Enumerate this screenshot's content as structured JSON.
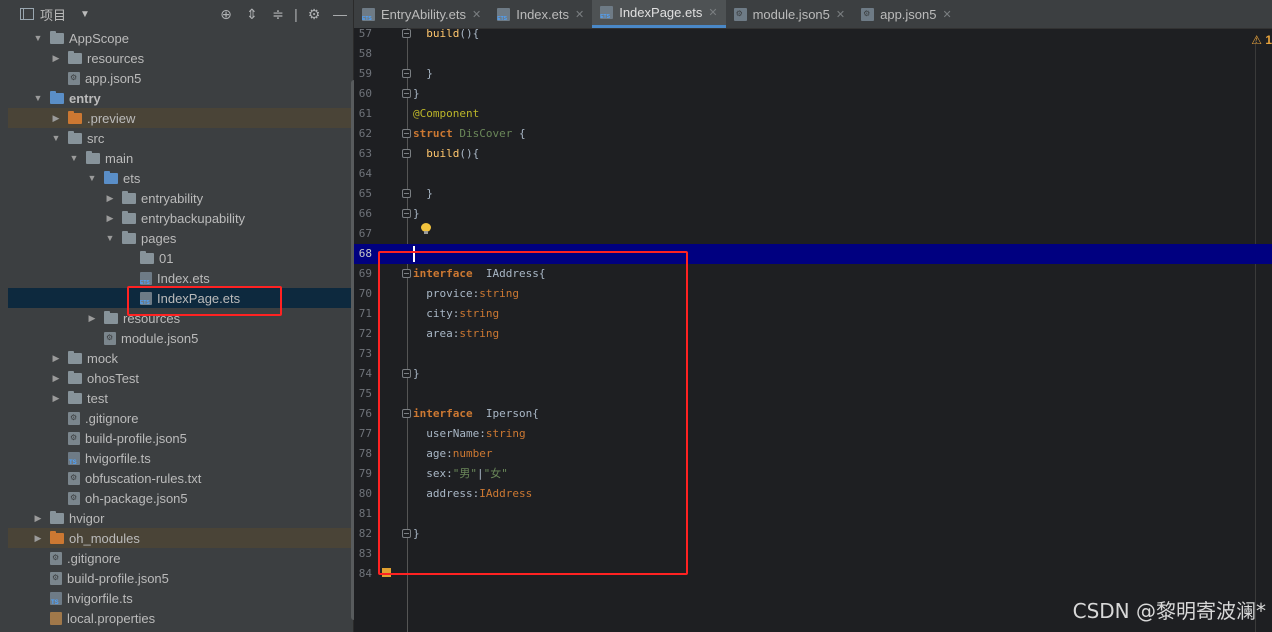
{
  "project_panel": {
    "title": "项目",
    "header_icons": [
      "crosshair-icon",
      "expand-all-icon",
      "collapse-all-icon",
      "gear-icon",
      "minimize-icon"
    ]
  },
  "tree": [
    {
      "label": "AppScope",
      "type": "folder",
      "expanded": true
    },
    {
      "label": "resources",
      "type": "folder",
      "expanded": false
    },
    {
      "label": "app.json5",
      "type": "config"
    },
    {
      "label": "entry",
      "type": "folder-blue",
      "expanded": true,
      "bold": true
    },
    {
      "label": ".preview",
      "type": "folder-orange",
      "expanded": false
    },
    {
      "label": "src",
      "type": "folder",
      "expanded": true
    },
    {
      "label": "main",
      "type": "folder",
      "expanded": true
    },
    {
      "label": "ets",
      "type": "folder-blue",
      "expanded": true
    },
    {
      "label": "entryability",
      "type": "folder",
      "expanded": false
    },
    {
      "label": "entrybackupability",
      "type": "folder",
      "expanded": false
    },
    {
      "label": "pages",
      "type": "folder",
      "expanded": true
    },
    {
      "label": "01",
      "type": "folder"
    },
    {
      "label": "Index.ets",
      "type": "ets"
    },
    {
      "label": "IndexPage.ets",
      "type": "ets",
      "selected": true
    },
    {
      "label": "resources",
      "type": "folder",
      "expanded": false
    },
    {
      "label": "module.json5",
      "type": "config"
    },
    {
      "label": "mock",
      "type": "folder",
      "expanded": false
    },
    {
      "label": "ohosTest",
      "type": "folder",
      "expanded": false
    },
    {
      "label": "test",
      "type": "folder",
      "expanded": false
    },
    {
      "label": ".gitignore",
      "type": "config"
    },
    {
      "label": "build-profile.json5",
      "type": "config"
    },
    {
      "label": "hvigorfile.ts",
      "type": "ts"
    },
    {
      "label": "obfuscation-rules.txt",
      "type": "config"
    },
    {
      "label": "oh-package.json5",
      "type": "config"
    },
    {
      "label": "hvigor",
      "type": "folder",
      "expanded": false
    },
    {
      "label": "oh_modules",
      "type": "folder-orange",
      "expanded": false
    },
    {
      "label": ".gitignore",
      "type": "config"
    },
    {
      "label": "build-profile.json5",
      "type": "config"
    },
    {
      "label": "hvigorfile.ts",
      "type": "ts"
    },
    {
      "label": "local.properties",
      "type": "props"
    }
  ],
  "tabs": [
    {
      "label": "EntryAbility.ets",
      "active": false,
      "icon": "ets"
    },
    {
      "label": "Index.ets",
      "active": false,
      "icon": "ets"
    },
    {
      "label": "IndexPage.ets",
      "active": true,
      "icon": "ets"
    },
    {
      "label": "module.json5",
      "active": false,
      "icon": "cfg"
    },
    {
      "label": "app.json5",
      "active": false,
      "icon": "cfg"
    }
  ],
  "editor": {
    "warning_count": "1",
    "current_line": 68,
    "lines": [
      {
        "n": "57",
        "tokens": [
          [
            "  ",
            ""
          ],
          [
            "build",
            "fn"
          ],
          [
            "(){",
            ""
          ]
        ]
      },
      {
        "n": "58",
        "tokens": []
      },
      {
        "n": "59",
        "tokens": [
          [
            "  }",
            ""
          ]
        ]
      },
      {
        "n": "60",
        "tokens": [
          [
            "}",
            ""
          ]
        ]
      },
      {
        "n": "61",
        "tokens": [
          [
            "@Component",
            "ann"
          ]
        ]
      },
      {
        "n": "62",
        "tokens": [
          [
            "struct ",
            "kw"
          ],
          [
            "DisCover",
            "dim"
          ],
          [
            " {",
            ""
          ]
        ]
      },
      {
        "n": "63",
        "tokens": [
          [
            "  ",
            ""
          ],
          [
            "build",
            "fn"
          ],
          [
            "(){",
            ""
          ]
        ]
      },
      {
        "n": "64",
        "tokens": []
      },
      {
        "n": "65",
        "tokens": [
          [
            "  }",
            ""
          ]
        ]
      },
      {
        "n": "66",
        "tokens": [
          [
            "}",
            ""
          ]
        ]
      },
      {
        "n": "67",
        "tokens": []
      },
      {
        "n": "68",
        "tokens": []
      },
      {
        "n": "69",
        "tokens": [
          [
            "interface ",
            "kw"
          ],
          [
            " IAddress{",
            ""
          ]
        ]
      },
      {
        "n": "70",
        "tokens": [
          [
            "  provice:",
            ""
          ],
          [
            "string",
            "typ"
          ]
        ]
      },
      {
        "n": "71",
        "tokens": [
          [
            "  city:",
            ""
          ],
          [
            "string",
            "typ"
          ]
        ]
      },
      {
        "n": "72",
        "tokens": [
          [
            "  area:",
            ""
          ],
          [
            "string",
            "typ"
          ]
        ]
      },
      {
        "n": "73",
        "tokens": []
      },
      {
        "n": "74",
        "tokens": [
          [
            "}",
            ""
          ]
        ]
      },
      {
        "n": "75",
        "tokens": []
      },
      {
        "n": "76",
        "tokens": [
          [
            "interface ",
            "kw"
          ],
          [
            " Iperson{",
            ""
          ]
        ]
      },
      {
        "n": "77",
        "tokens": [
          [
            "  userName:",
            ""
          ],
          [
            "string",
            "typ"
          ]
        ]
      },
      {
        "n": "78",
        "tokens": [
          [
            "  age:",
            ""
          ],
          [
            "number",
            "typ"
          ]
        ]
      },
      {
        "n": "79",
        "tokens": [
          [
            "  sex:",
            ""
          ],
          [
            "\"男\"",
            "str"
          ],
          [
            "|",
            ""
          ],
          [
            "\"女\"",
            "str"
          ]
        ]
      },
      {
        "n": "80",
        "tokens": [
          [
            "  address:",
            ""
          ],
          [
            "IAddress",
            "typ"
          ]
        ]
      },
      {
        "n": "81",
        "tokens": []
      },
      {
        "n": "82",
        "tokens": [
          [
            "}",
            ""
          ]
        ]
      },
      {
        "n": "83",
        "tokens": []
      },
      {
        "n": "84",
        "tokens": []
      }
    ]
  },
  "watermark": "CSDN @黎明寄波澜*"
}
